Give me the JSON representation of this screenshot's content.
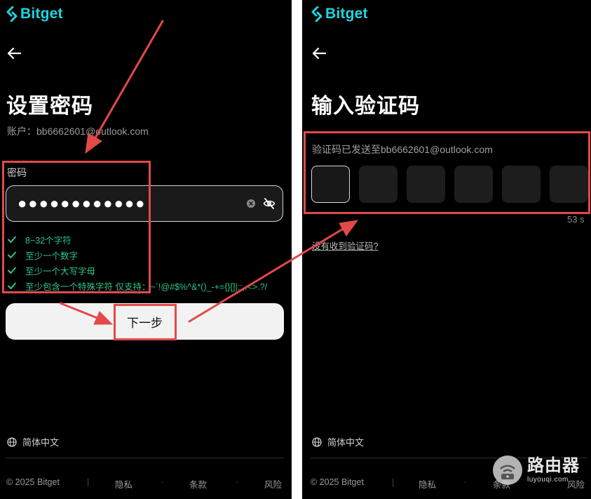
{
  "brand": {
    "name": "Bitget",
    "color": "#1ed5e0"
  },
  "set_password": {
    "title": "设置密码",
    "account_label": "账户：",
    "account_email": "bb6662601@outlook.com",
    "password_label": "密码",
    "password_mask": "●●●●●●●●●●●●",
    "rules": [
      "8~32个字符",
      "至少一个数字",
      "至少一个大写字母",
      "至少包含一个特殊字符 仅支持：~`!@#$%^&*()_-+={}[]|;:,.<>.?/"
    ],
    "next_label": "下一步",
    "language": "简体中文",
    "footer": {
      "copyright": "© 2025 Bitget",
      "privacy": "隐私",
      "terms": "条款",
      "risk": "风险"
    }
  },
  "verify": {
    "title": "输入验证码",
    "description": "验证码已发送至bb6662601@outlook.com",
    "code_length": 6,
    "countdown": "53 s",
    "resend_label": "没有收到验证码?",
    "language": "简体中文",
    "footer": {
      "copyright": "© 2025 Bitget",
      "privacy": "隐私",
      "terms": "条款",
      "risk": "风险"
    }
  },
  "watermark": {
    "title": "路由器",
    "subtitle": "luyouqi.com"
  },
  "colors": {
    "accent_red": "#e34949",
    "rule_green": "#2bc58b",
    "background": "#000000"
  }
}
